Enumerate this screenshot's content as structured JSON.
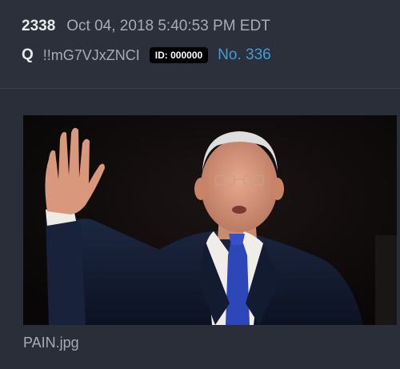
{
  "post": {
    "number": "2338",
    "timestamp": "Oct 04, 2018 5:40:53 PM EDT",
    "author": "Q",
    "tripcode": "!!mG7VJxZNCI",
    "id_badge": "ID: 000000",
    "post_link": "No. 336"
  },
  "attachment": {
    "filename": "PAIN.jpg",
    "image_icon": "photo-icon"
  },
  "colors": {
    "background": "#292e38",
    "link": "#3f9ddb",
    "badge": "#000000"
  }
}
